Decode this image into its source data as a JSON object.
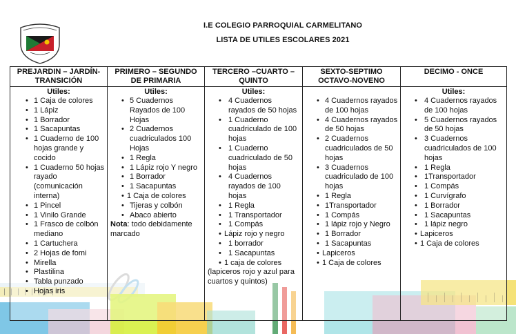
{
  "header": {
    "school_name": "I.E COLEGIO PARROQUIAL CARMELITANO",
    "list_title": "LISTA DE UTILES ESCOLARES 2021"
  },
  "table": {
    "columns": [
      {
        "header": "PREJARDIN – JARDÍN-TRANSICIÓN",
        "subheading": "Utiles:",
        "items": [
          "1 Caja de colores",
          "1 Lápiz",
          "1 Borrador",
          "1 Sacapuntas",
          "1 Cuaderno de 100 hojas grande y cocido",
          "1 Cuaderno 50 hojas rayado (comunicación interna)",
          "1 Pincel",
          "1 Vinilo Grande",
          "1 Frasco de colbón mediano",
          "1 Cartuchera",
          "2 Hojas de fomi",
          "Mirella",
          "Plastilina",
          "Tabla punzado",
          "Hojas iris"
        ],
        "note_label": "",
        "note": ""
      },
      {
        "header": "PRIMERO – SEGUNDO DE PRIMARIA",
        "subheading": "Utiles:",
        "items": [
          "5 Cuadernos Rayados de 100 Hojas",
          "2 Cuadernos cuadriculados 100 Hojas",
          "1 Regla",
          "1 Lápiz rojo Y negro",
          "1 Borrador",
          "1 Sacapuntas",
          "1 Caja de colores",
          "Tijeras y colbón",
          "Abaco abierto"
        ],
        "note_label": "Nota",
        "note": ": todo debidamente marcado"
      },
      {
        "header": "TERCERO –CUARTO – QUINTO",
        "subheading": "Utiles:",
        "items": [
          "4 Cuadernos rayados de 50 hojas",
          "1 Cuaderno cuadriculado de 100 hojas",
          "1 Cuaderno cuadriculado de 50 hojas",
          "4 Cuadernos rayados de 100 hojas",
          "1 Regla",
          "1 Transportador",
          "1 Compás",
          "Lápiz rojo y negro",
          "1 borrador",
          "1 Sacapuntas",
          "1 caja de colores"
        ],
        "note_label": "",
        "note": "(lapiceros rojo y azul para cuartos y quintos)"
      },
      {
        "header": "SEXTO-SEPTIMO OCTAVO-NOVENO",
        "subheading": "",
        "items": [
          "4 Cuadernos rayados de 100 hojas",
          "4 Cuadernos rayados de 50 hojas",
          "2 Cuadernos cuadriculados de 50 hojas",
          "3 Cuadernos cuadriculado de 100 hojas",
          "1 Regla",
          "1Transportador",
          "1 Compás",
          "1 lápiz rojo y Negro",
          "1 Borrador",
          "1 Sacapuntas",
          "Lapiceros",
          "1 Caja de colores"
        ],
        "note_label": "",
        "note": ""
      },
      {
        "header": "DECIMO - ONCE",
        "subheading": "Utiles:",
        "items": [
          "4 Cuadernos rayados de 100 hojas",
          "5 Cuadernos rayados de 50 hojas",
          "3 Cuadernos cuadriculados de 100 hojas",
          "1 Regla",
          "1Transportador",
          "1 Compás",
          "1 Curvígrafo",
          "1 Borrador",
          "1 Sacapuntas",
          "1 lápiz negro",
          "Lapiceros",
          "1 Caja de colores"
        ],
        "note_label": "",
        "note": ""
      }
    ]
  }
}
